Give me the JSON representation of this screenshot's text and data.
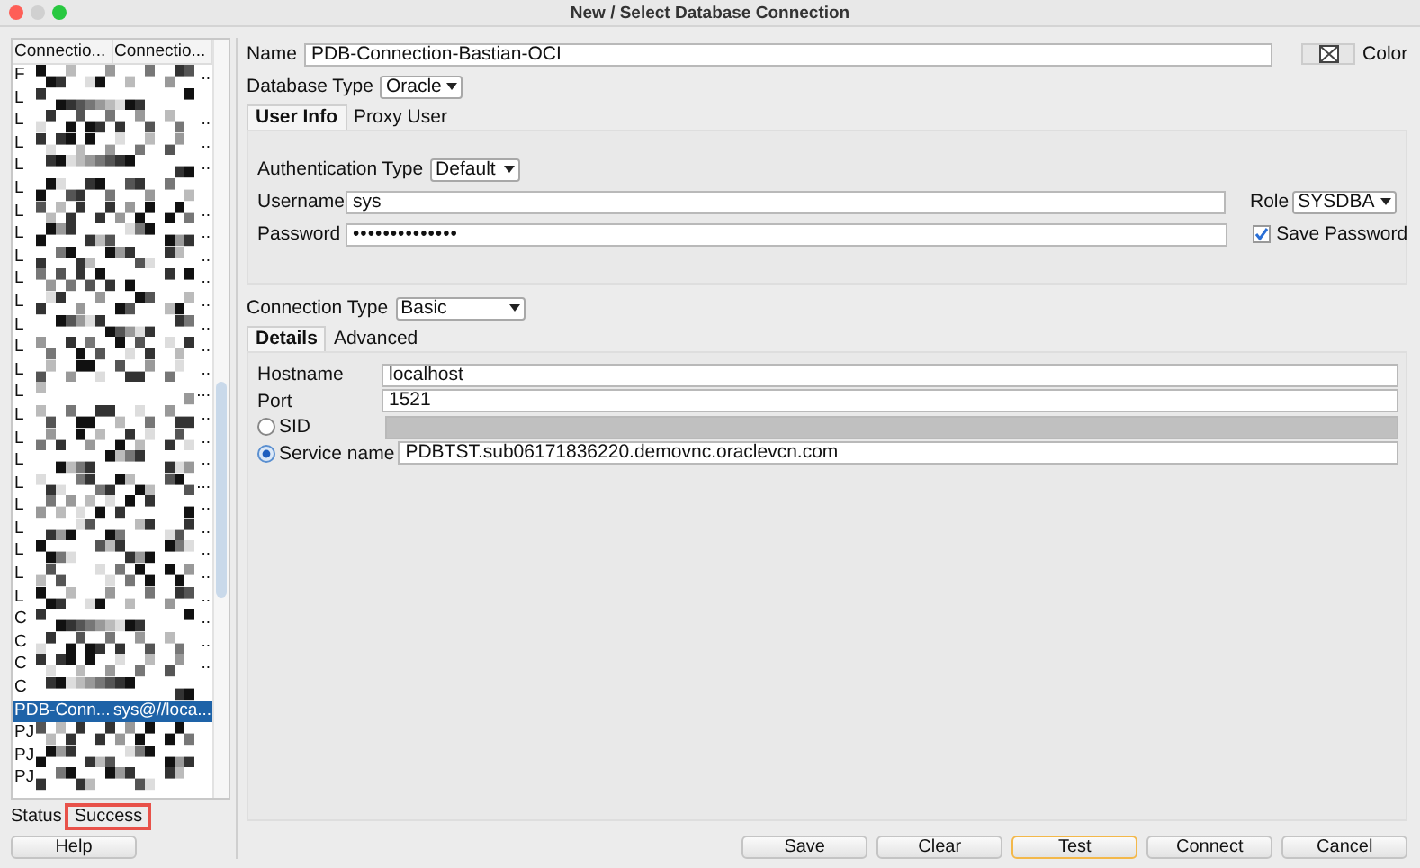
{
  "window": {
    "title": "New / Select Database Connection"
  },
  "connections": {
    "columns": [
      "Connectio...",
      "Connectio..."
    ],
    "rows": [
      {
        "kind": "redacted",
        "name": "F",
        "tail": "..",
        "selected": false
      },
      {
        "kind": "redacted",
        "name": "L",
        "selected": false
      },
      {
        "kind": "redacted",
        "name": "L",
        "tail": "..",
        "selected": false
      },
      {
        "kind": "redacted",
        "name": "L",
        "tail": "..",
        "selected": false
      },
      {
        "kind": "redacted",
        "name": "L",
        "tail": "..",
        "selected": false
      },
      {
        "kind": "redacted",
        "name": "L",
        "selected": false
      },
      {
        "kind": "redacted",
        "name": "L",
        "tail": "..",
        "selected": false
      },
      {
        "kind": "redacted",
        "name": "L",
        "tail": "..",
        "selected": false
      },
      {
        "kind": "redacted",
        "name": "L",
        "tail": "..",
        "selected": false
      },
      {
        "kind": "redacted",
        "name": "L",
        "tail": "..",
        "selected": false
      },
      {
        "kind": "redacted",
        "name": "L",
        "tail": "..",
        "selected": false
      },
      {
        "kind": "redacted",
        "name": "L",
        "tail": "..",
        "selected": false
      },
      {
        "kind": "redacted",
        "name": "L",
        "tail": "..",
        "selected": false
      },
      {
        "kind": "redacted",
        "name": "L",
        "tail": "..",
        "selected": false
      },
      {
        "kind": "redacted",
        "name": "L",
        "tail": "...",
        "selected": false
      },
      {
        "kind": "redacted",
        "name": "L",
        "tail": "..",
        "selected": false
      },
      {
        "kind": "redacted",
        "name": "L",
        "tail": "..",
        "selected": false
      },
      {
        "kind": "redacted",
        "name": "L",
        "tail": "..",
        "selected": false
      },
      {
        "kind": "redacted",
        "name": "L",
        "tail": "...",
        "selected": false
      },
      {
        "kind": "redacted",
        "name": "L",
        "tail": "..",
        "selected": false
      },
      {
        "kind": "redacted",
        "name": "L",
        "tail": "..",
        "selected": false
      },
      {
        "kind": "redacted",
        "name": "L",
        "tail": "..",
        "selected": false
      },
      {
        "kind": "redacted",
        "name": "L",
        "tail": "..",
        "selected": false
      },
      {
        "kind": "redacted",
        "name": "L",
        "tail": "..",
        "selected": false
      },
      {
        "kind": "redacted",
        "name": "C",
        "tail": "..",
        "selected": false
      },
      {
        "kind": "redacted",
        "name": "C",
        "tail": "..",
        "selected": false
      },
      {
        "kind": "redacted",
        "name": "C",
        "tail": "..",
        "selected": false
      },
      {
        "kind": "redacted",
        "name": "C",
        "selected": false
      },
      {
        "kind": "plain",
        "name": "PDB-Conn...",
        "tail": "sys@//loca...",
        "selected": true
      },
      {
        "kind": "redacted",
        "name": "PJ",
        "selected": false
      },
      {
        "kind": "redacted",
        "name": "PJ",
        "selected": false
      },
      {
        "kind": "redacted",
        "name": "PJ",
        "selected": false
      }
    ]
  },
  "status": {
    "label": "Status",
    "value": "Success",
    "highlighted": true
  },
  "help_button": "Help",
  "form": {
    "name_label": "Name",
    "name": "PDB-Connection-Bastian-OCI",
    "color_label": "Color",
    "db_type_label": "Database Type",
    "db_type": "Oracle",
    "tabs": [
      {
        "label": "User Info",
        "selected": true
      },
      {
        "label": "Proxy User",
        "selected": false
      }
    ],
    "auth_label": "Authentication Type",
    "auth": "Default",
    "username_label": "Username",
    "username": "sys",
    "password_label": "Password",
    "password": "••••••••••••••",
    "role_label": "Role",
    "role": "SYSDBA",
    "save_password": {
      "label": "Save Password",
      "checked": true
    },
    "conn_type_label": "Connection Type",
    "conn_type": "Basic",
    "conn_tabs": [
      {
        "label": "Details",
        "selected": true
      },
      {
        "label": "Advanced",
        "selected": false
      }
    ],
    "fields": [
      {
        "kind": "text",
        "label": "Hostname",
        "value": "localhost"
      },
      {
        "kind": "text",
        "label": "Port",
        "value": "1521"
      },
      {
        "kind": "radio",
        "label": "SID",
        "selected": false
      },
      {
        "kind": "radio",
        "label": "Service name",
        "value": "PDBTST.sub06171836220.demovnc.oraclevcn.com",
        "selected": true
      }
    ]
  },
  "buttons": [
    {
      "label": "Save",
      "focused": false
    },
    {
      "label": "Clear",
      "focused": false
    },
    {
      "label": "Test",
      "focused": true
    },
    {
      "label": "Connect",
      "focused": false
    },
    {
      "label": "Cancel",
      "focused": false
    }
  ]
}
